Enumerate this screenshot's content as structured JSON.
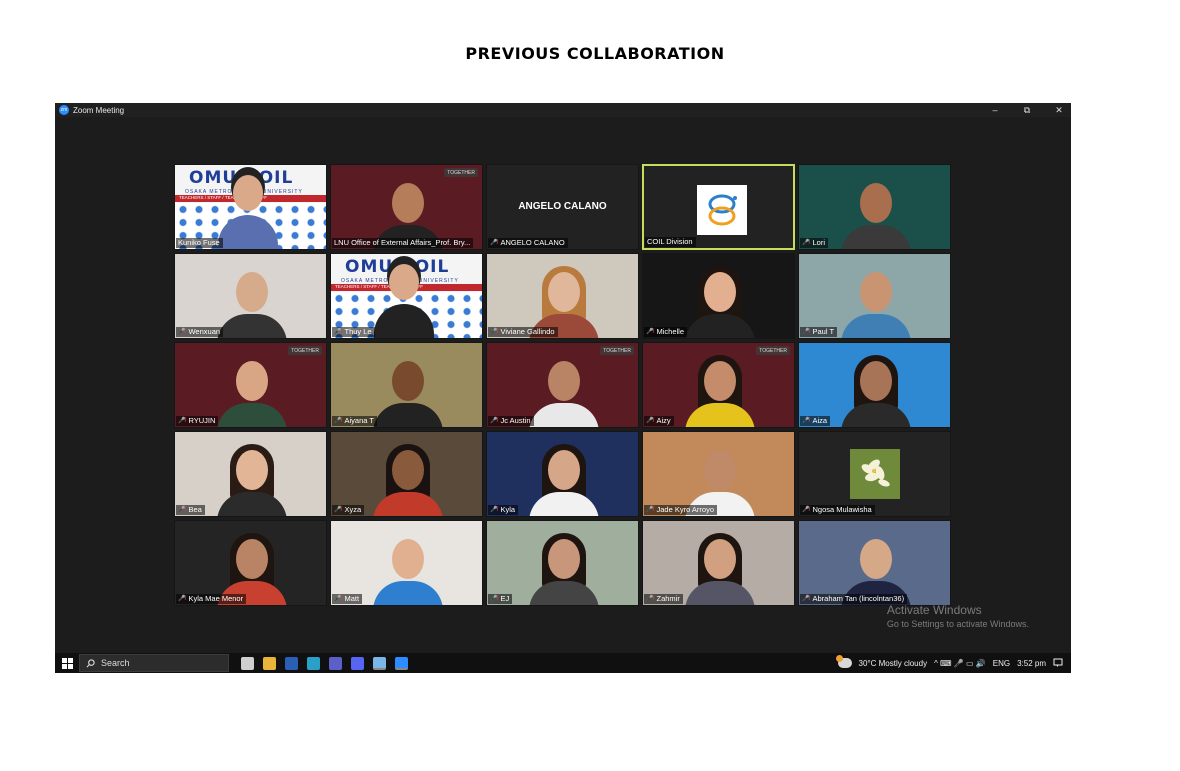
{
  "document": {
    "title": "PREVIOUS COLLABORATION"
  },
  "window": {
    "title": "Zoom Meeting",
    "logo_text": "zm",
    "controls": {
      "minimize": "–",
      "restore": "⧉",
      "close": "✕"
    }
  },
  "participants": [
    {
      "name": "Kuniko Fuse",
      "muted": false,
      "bg": "#f4f4f4",
      "type": "omu"
    },
    {
      "name": "LNU Office of External Affairs_Prof. Bry...",
      "muted": false,
      "bg": "#5a1c22",
      "skin": "#b57d5a",
      "shirt": "#222",
      "badge": true
    },
    {
      "name": "ANGELO CALANO",
      "muted": true,
      "bg": "#222222",
      "type": "name",
      "display": "ANGELO CALANO"
    },
    {
      "name": "COIL Division",
      "muted": false,
      "bg": "#222222",
      "type": "coil",
      "active": true
    },
    {
      "name": "Lori",
      "muted": true,
      "bg": "#1b4f4a",
      "skin": "#a86e4d",
      "shirt": "#3a3a3a"
    },
    {
      "name": "Wenxuan",
      "muted": true,
      "bg": "#d9d4cf",
      "skin": "#d6ab8c",
      "shirt": "#333"
    },
    {
      "name": "Thuy Le",
      "muted": true,
      "bg": "#f4f4f4",
      "type": "omu"
    },
    {
      "name": "Viviane Gallindo",
      "muted": true,
      "bg": "#cfc8bd",
      "skin": "#e0b79a",
      "shirt": "#9b4a3a",
      "hair": "#b87a3d"
    },
    {
      "name": "Michelle",
      "muted": true,
      "bg": "#161616",
      "skin": "#e2b091",
      "shirt": "#222",
      "hair": "#1e1410"
    },
    {
      "name": "Paul T",
      "muted": true,
      "bg": "#8da7a9",
      "skin": "#c99472",
      "shirt": "#3f7fb4"
    },
    {
      "name": "RYUJIN",
      "muted": true,
      "bg": "#5a1c22",
      "skin": "#d9a685",
      "shirt": "#2e4e3c",
      "badge": true
    },
    {
      "name": "Aiyana T",
      "muted": true,
      "bg": "#9a8b5f",
      "skin": "#7a4a2e",
      "shirt": "#222"
    },
    {
      "name": "Jc Austin",
      "muted": true,
      "bg": "#5a1c22",
      "skin": "#b98466",
      "shirt": "#e8e8e8",
      "badge": true
    },
    {
      "name": "Aizy",
      "muted": true,
      "bg": "#5a1c22",
      "skin": "#c48c6a",
      "shirt": "#e6c21c",
      "badge": true,
      "hair": "#1e1410"
    },
    {
      "name": "Aiza",
      "muted": true,
      "bg": "#2f89d2",
      "skin": "#a87458",
      "shirt": "#2a2a2a",
      "hair": "#1e1410"
    },
    {
      "name": "Bea",
      "muted": true,
      "bg": "#d7d0c9",
      "skin": "#e2b596",
      "shirt": "#2b2b2b",
      "hair": "#2a1c14"
    },
    {
      "name": "Xyza",
      "muted": true,
      "bg": "#5a4a3a",
      "skin": "#8a5a3c",
      "shirt": "#c23a2a",
      "hair": "#1a1210"
    },
    {
      "name": "Kyla",
      "muted": true,
      "bg": "#1f2f5e",
      "skin": "#d6a688",
      "shirt": "#f1f1f1",
      "hair": "#1e1410"
    },
    {
      "name": "Jade Kyro Arroyo",
      "muted": true,
      "bg": "#c28a5a",
      "skin": "#c08a68",
      "shirt": "#f2f2f2"
    },
    {
      "name": "Ngosa Mulawisha",
      "muted": true,
      "bg": "#232323",
      "type": "flower"
    },
    {
      "name": "Kyla Mae Menor",
      "muted": true,
      "bg": "#242424",
      "skin": "#b98466",
      "shirt": "#c8402f",
      "hair": "#1e1410"
    },
    {
      "name": "Matt",
      "muted": true,
      "bg": "#e8e4e0",
      "skin": "#e0b090",
      "shirt": "#2f7fd0"
    },
    {
      "name": "EJ",
      "muted": true,
      "bg": "#9fae9d",
      "skin": "#c8967a",
      "shirt": "#444",
      "hair": "#1e1410"
    },
    {
      "name": "Zahmir",
      "muted": true,
      "bg": "#b5ada5",
      "skin": "#d0a080",
      "shirt": "#556",
      "hair": "#1e1410"
    },
    {
      "name": "Abraham Tan (lincolntan36)",
      "muted": true,
      "bg": "#5a6a8a",
      "skin": "#d5a888",
      "shirt": "#1f2540"
    }
  ],
  "omu_banner": {
    "title": "OMU-COIL",
    "subtitle": "OSAKA METROPOLITAN UNIVERSITY",
    "strip": "TEACHERS / STAFF / TEACHERS / STAFF"
  },
  "badge_text": "TOGETHER",
  "watermark": {
    "line1": "Activate Windows",
    "line2": "Go to Settings to activate Windows."
  },
  "taskbar": {
    "search_placeholder": "Search",
    "weather": "30°C  Mostly cloudy",
    "tray_icons": "^ ⌨ 🎤 ▭ 🔊",
    "language": "ENG",
    "time": "3:52 pm",
    "apps": [
      {
        "name": "task-view-icon",
        "color": "#cfcfcf"
      },
      {
        "name": "file-explorer-icon",
        "color": "#e8b43a"
      },
      {
        "name": "word-icon",
        "color": "#2b5fb5"
      },
      {
        "name": "edge-icon",
        "color": "#2aa0c9"
      },
      {
        "name": "teams-icon",
        "color": "#5b5fc7"
      },
      {
        "name": "discord-icon",
        "color": "#5865f2"
      },
      {
        "name": "notepad-icon",
        "color": "#7bb6e8"
      },
      {
        "name": "zoom-icon",
        "color": "#2d8cff"
      }
    ]
  }
}
